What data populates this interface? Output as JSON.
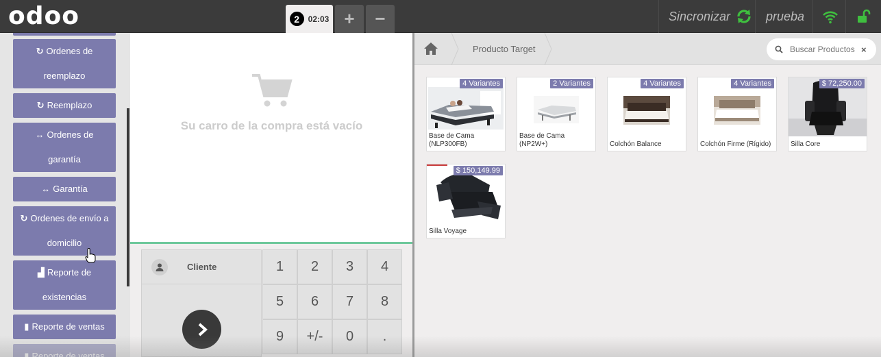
{
  "header": {
    "logo": "odoo",
    "order_number": "2",
    "order_time": "02:03",
    "add_order": "+",
    "remove_order": "−",
    "sync_label": "Sincronizar",
    "user": "prueba",
    "colors": {
      "bar": "#3b3b3b",
      "sync_icon": "#3fbf3f",
      "wifi": "#3fbf3f",
      "lock": "#3fbf3f"
    }
  },
  "sidebar": {
    "accent": "#7c7bad",
    "items": [
      {
        "icon": "refresh-icon",
        "glyph": "↻",
        "label": "Ordenes de reemplazo"
      },
      {
        "icon": "refresh-icon",
        "glyph": "↻",
        "label": "Reemplazo"
      },
      {
        "icon": "arrows-h-icon",
        "glyph": "↔",
        "label": "Ordenes de garantía"
      },
      {
        "icon": "arrows-h-icon",
        "glyph": "↔",
        "label": "Garantía"
      },
      {
        "icon": "refresh-icon",
        "glyph": "↻",
        "label": "Ordenes de envío a domicilio"
      },
      {
        "icon": "area-chart-icon",
        "glyph": "▟",
        "label": "Reporte de existencias"
      },
      {
        "icon": "file-icon",
        "glyph": "▮",
        "label": "Reporte de ventas"
      },
      {
        "icon": "file-icon",
        "glyph": "▮",
        "label": "Reporte de ventas"
      }
    ]
  },
  "order": {
    "empty_message": "Su carro de la compra está vacío"
  },
  "pad": {
    "client_label": "Cliente",
    "keys": [
      "1",
      "2",
      "3",
      "4",
      "5",
      "6",
      "7",
      "8",
      "9",
      "+/-",
      "0",
      "."
    ]
  },
  "products_header": {
    "breadcrumb": "Producto Target",
    "search_placeholder": "Buscar Productos",
    "clear": "×"
  },
  "products": [
    {
      "name": "Base de Cama (NLP300FB)",
      "badge": "4 Variantes"
    },
    {
      "name": "Base de Cama (NP2W+)",
      "badge": "2 Variantes"
    },
    {
      "name": "Colchón Balance",
      "badge": "4 Variantes"
    },
    {
      "name": "Colchón Firme (Rígido)",
      "badge": "4 Variantes"
    },
    {
      "name": "Silla Core",
      "badge": "$ 72,250.00"
    },
    {
      "name": "Silla Voyage",
      "badge": "$ 150,149.99"
    }
  ]
}
